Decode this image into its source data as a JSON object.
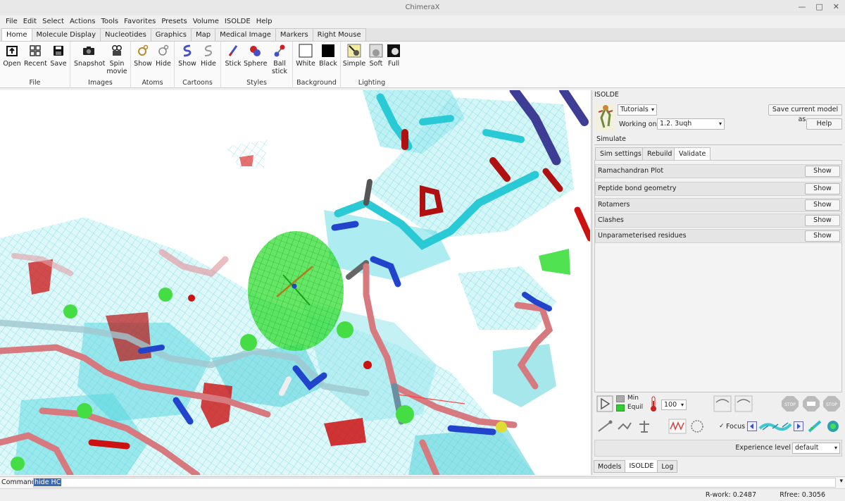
{
  "window": {
    "title": "ChimeraX"
  },
  "menu": [
    "File",
    "Edit",
    "Select",
    "Actions",
    "Tools",
    "Favorites",
    "Presets",
    "Volume",
    "ISOLDE",
    "Help"
  ],
  "tabs": [
    "Home",
    "Molecule Display",
    "Nucleotides",
    "Graphics",
    "Map",
    "Medical Image",
    "Markers",
    "Right Mouse"
  ],
  "ribbon": {
    "file": {
      "label": "File",
      "open": "Open",
      "recent": "Recent",
      "save": "Save"
    },
    "images": {
      "label": "Images",
      "snapshot": "Snapshot",
      "spin1": "Spin",
      "spin2": "movie"
    },
    "atoms": {
      "label": "Atoms",
      "show": "Show",
      "hide": "Hide"
    },
    "cartoons": {
      "label": "Cartoons",
      "show": "Show",
      "hide": "Hide"
    },
    "styles": {
      "label": "Styles",
      "stick": "Stick",
      "sphere": "Sphere",
      "ball1": "Ball",
      "ball2": "stick"
    },
    "background": {
      "label": "Background",
      "white": "White",
      "black": "Black"
    },
    "lighting": {
      "label": "Lighting",
      "simple": "Simple",
      "soft": "Soft",
      "full": "Full"
    }
  },
  "isolde": {
    "title": "ISOLDE",
    "tutorials": "Tutorials",
    "save_model": "Save current model as...",
    "working_on_label": "Working on:",
    "working_on_value": "1.2. 3uqh",
    "help": "Help",
    "simulate": "Simulate",
    "subtabs": [
      "Sim settings",
      "Rebuild",
      "Validate"
    ],
    "validate_items": [
      "Ramachandran Plot",
      "Peptide bond geometry",
      "Rotamers",
      "Clashes",
      "Unparameterised residues"
    ],
    "show_label": "Show",
    "min_label": "Min",
    "equil_label": "Equil",
    "temperature": "100",
    "stop_label": "STOP",
    "focus_label": "Focus",
    "experience_label": "Experience level",
    "experience_value": "default"
  },
  "bottom_tabs": [
    "Models",
    "ISOLDE",
    "Log"
  ],
  "command": {
    "label": "Command:",
    "value": "hide HC"
  },
  "status": {
    "rwork": "R-work: 0.2487",
    "rfree": "Rfree: 0.3056"
  },
  "colors": {
    "cyan": "#4fd6df",
    "green": "#33dd33",
    "salmon": "#d67a80",
    "red": "#cc1111",
    "blue": "#2244cc"
  }
}
